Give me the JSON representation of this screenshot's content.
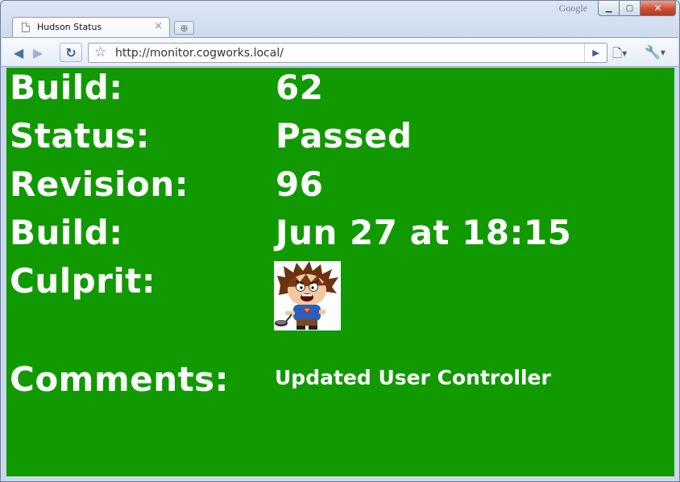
{
  "browser": {
    "brand_mark": "Google",
    "tab_title": "Hudson Status",
    "url": "http://monitor.cogworks.local/"
  },
  "status": {
    "build_label": "Build:",
    "build_value": "62",
    "status_label": "Status:",
    "status_value": "Passed",
    "revision_label": "Revision:",
    "revision_value": "96",
    "date_label": "Build:",
    "date_value": "Jun 27 at 18:15",
    "culprit_label": "Culprit:",
    "comments_label": "Comments:",
    "comments_value": "Updated User Controller"
  },
  "colors": {
    "page_background": "#119900",
    "text": "#ffffff"
  },
  "icons": [
    "page-icon",
    "close-icon",
    "new-tab-icon",
    "back-icon",
    "forward-icon",
    "reload-icon",
    "star-icon",
    "go-icon",
    "page-menu-icon",
    "wrench-icon"
  ]
}
